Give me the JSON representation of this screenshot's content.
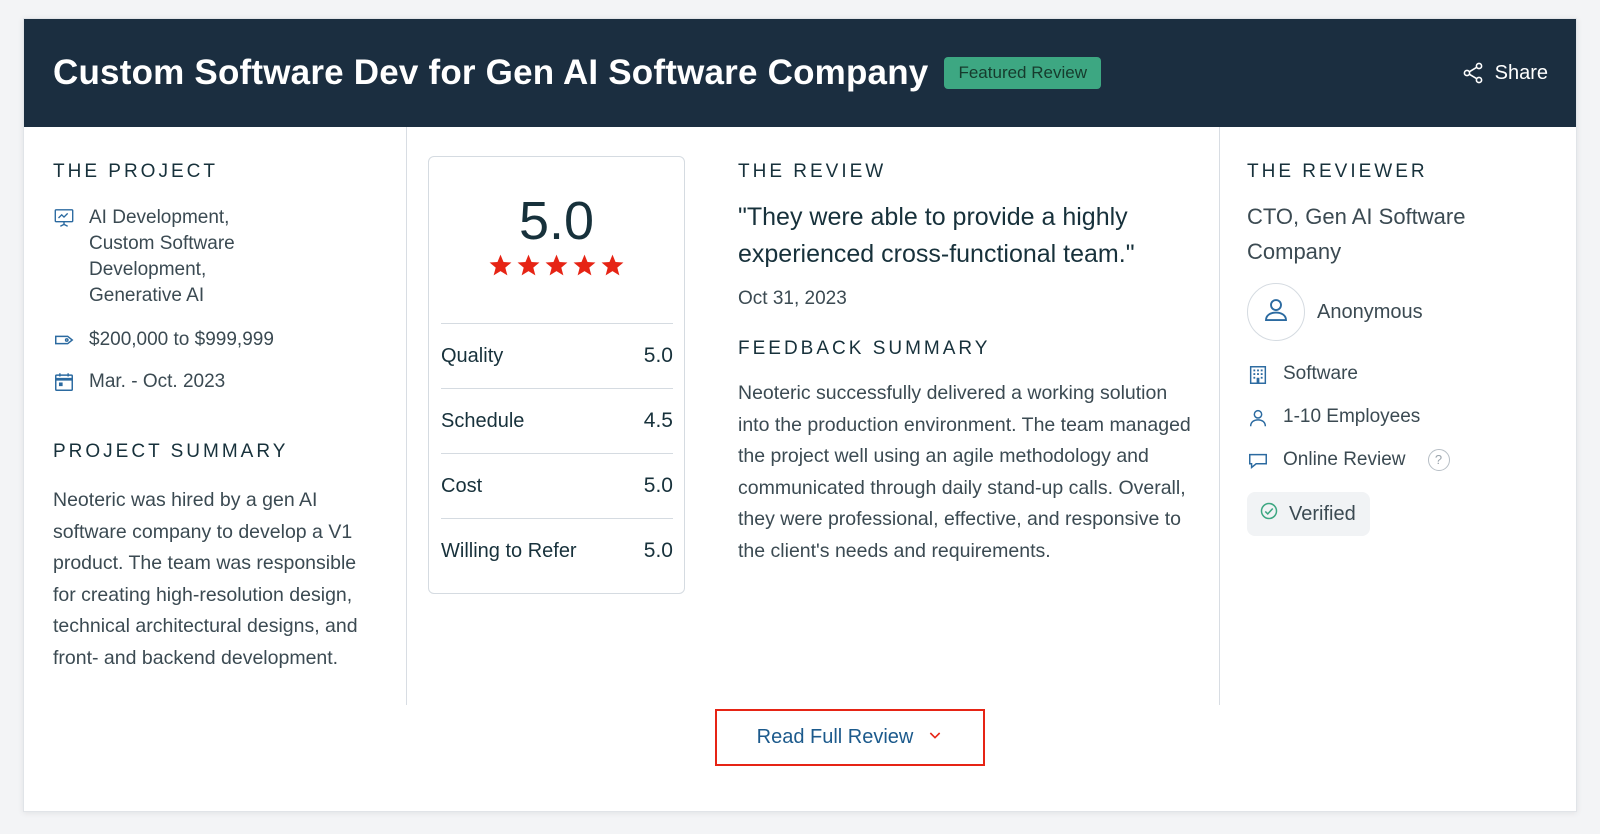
{
  "header": {
    "title": "Custom Software Dev for Gen AI Software Company",
    "badge": "Featured Review",
    "share_label": "Share"
  },
  "project": {
    "section_label": "THE PROJECT",
    "services_lines": [
      "AI Development,",
      "Custom Software",
      "Development,",
      "Generative AI"
    ],
    "budget": "$200,000 to $999,999",
    "dates": "Mar. - Oct. 2023",
    "summary_label": "PROJECT SUMMARY",
    "summary_text": "Neoteric was hired by a gen AI software company to develop a V1 product. The team was responsible for creating high-resolution design, technical architectural designs, and front- and backend development."
  },
  "ratings": {
    "overall": "5.0",
    "stars": 5,
    "items": [
      {
        "label": "Quality",
        "value": "5.0"
      },
      {
        "label": "Schedule",
        "value": "4.5"
      },
      {
        "label": "Cost",
        "value": "5.0"
      },
      {
        "label": "Willing to Refer",
        "value": "5.0"
      }
    ]
  },
  "review": {
    "section_label": "THE REVIEW",
    "quote": "\"They were able to provide a highly experienced cross-functional team.\"",
    "date": "Oct 31, 2023",
    "feedback_label": "FEEDBACK SUMMARY",
    "feedback_text": "Neoteric successfully delivered a working solution into the production environment. The team managed the project well using an agile methodology and communicated through daily stand-up calls. Overall, they were professional, effective, and responsive to the client's needs and requirements."
  },
  "reviewer": {
    "section_label": "THE REVIEWER",
    "title": "CTO, Gen AI Software Company",
    "name": "Anonymous",
    "industry": "Software",
    "size": "1-10 Employees",
    "review_type": "Online Review",
    "help_glyph": "?",
    "verified_label": "Verified"
  },
  "actions": {
    "read_full_label": "Read Full Review"
  },
  "colors": {
    "header_bg": "#1b2e40",
    "badge_bg": "#3da782",
    "star": "#e62415",
    "icon_blue": "#2b6aa0",
    "button_border": "#e62415",
    "button_text": "#1c5a8c"
  }
}
